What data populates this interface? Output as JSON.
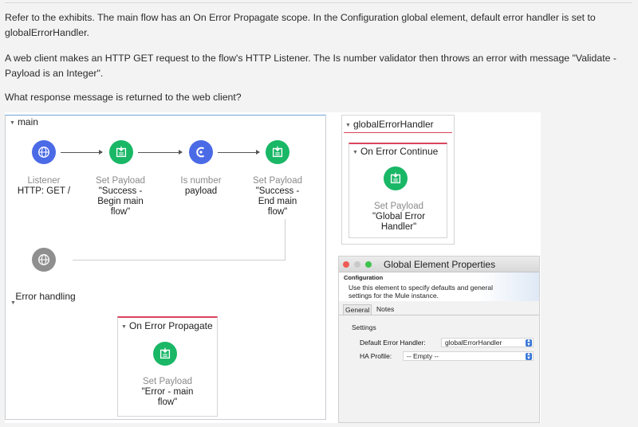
{
  "question": {
    "p1": "Refer to the exhibits. The main flow has an On Error Propagate scope. In the Configuration global element, default error handler is set to globalErrorHandler.",
    "p2": "A web client makes an HTTP GET request to the flow's HTTP Listener. The Is number validator then throws an error with message \"Validate - Payload is an Integer\".",
    "p3": "What response message is returned to the web client?"
  },
  "main_flow": {
    "name": "main",
    "nodes": [
      {
        "type": "Listener",
        "value": "HTTP: GET /",
        "icon": "globe-icon"
      },
      {
        "type": "Set Payload",
        "value": "\"Success - Begin main flow\"",
        "icon": "set-payload-icon"
      },
      {
        "type": "Is number",
        "value": "payload",
        "icon": "validator-icon"
      },
      {
        "type": "Set Payload",
        "value": "\"Success - End main flow\"",
        "icon": "set-payload-icon"
      }
    ],
    "error_handling_label": "Error handling",
    "on_error_propagate": {
      "title": "On Error Propagate",
      "node": {
        "type": "Set Payload",
        "value": "\"Error - main flow\""
      }
    }
  },
  "global_error_handler": {
    "name": "globalErrorHandler",
    "on_error_continue": {
      "title": "On Error Continue",
      "node": {
        "type": "Set Payload",
        "value": "\"Global Error Handler\""
      }
    }
  },
  "properties": {
    "window_title": "Global Element Properties",
    "section": "Configuration",
    "description": "Use this element to specify defaults and general settings for the Mule instance.",
    "tabs": [
      "General",
      "Notes"
    ],
    "settings_title": "Settings",
    "default_error_handler_label": "Default Error Handler:",
    "default_error_handler_value": "globalErrorHandler",
    "ha_profile_label": "HA Profile:",
    "ha_profile_value": "-- Empty --"
  },
  "colors": {
    "listener": "#4b6ae6",
    "set_payload": "#19b766",
    "error_source": "#8f8f8f",
    "scope_border": "#d9445b"
  }
}
